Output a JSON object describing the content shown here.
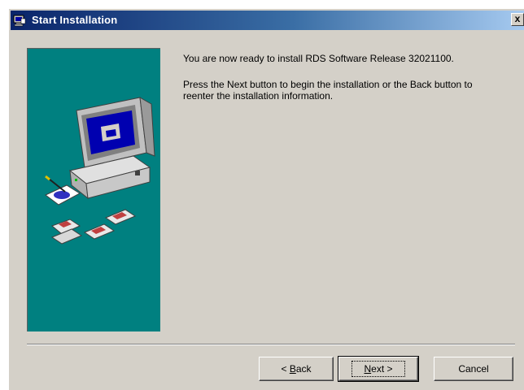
{
  "window": {
    "title": "Start Installation",
    "close_glyph": "x",
    "title_icon": "setup-icon"
  },
  "content": {
    "message_ready": "You are now ready to install RDS Software Release 32021100.",
    "message_instructions": "Press the Next button to begin the installation or the Back button to reenter the installation information."
  },
  "side_panel": {
    "background_color": "#008080",
    "illustration": "computer-with-disks-illustration"
  },
  "buttons": {
    "back_prefix": "< ",
    "back_accel": "B",
    "back_rest": "ack",
    "next_accel": "N",
    "next_rest": "ext >",
    "cancel_label": "Cancel"
  }
}
